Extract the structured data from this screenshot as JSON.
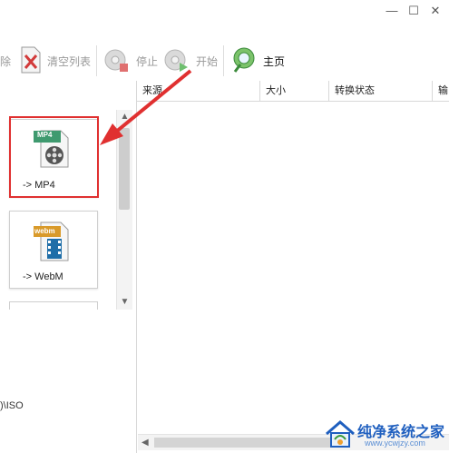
{
  "window": {
    "minimize": "—",
    "maximize": "☐",
    "close": "✕"
  },
  "toolbar": {
    "remove_label": "除",
    "clear_list_label": "清空列表",
    "stop_label": "停止",
    "start_label": "开始",
    "home_label": "主页"
  },
  "formats": [
    {
      "badge": "MP4",
      "label": "-> MP4"
    },
    {
      "badge": "webm",
      "label": "-> WebM"
    }
  ],
  "left_footer": {
    "path_text": ")\\ISO"
  },
  "table": {
    "columns": [
      "来源",
      "大小",
      "转换状态",
      "输"
    ]
  },
  "watermark": {
    "title": "纯净系统之家",
    "url": "www.ycwjzy.com"
  },
  "colors": {
    "highlight": "#e03030",
    "arrow": "#e03030",
    "home_icon": "#3a9a3a"
  }
}
